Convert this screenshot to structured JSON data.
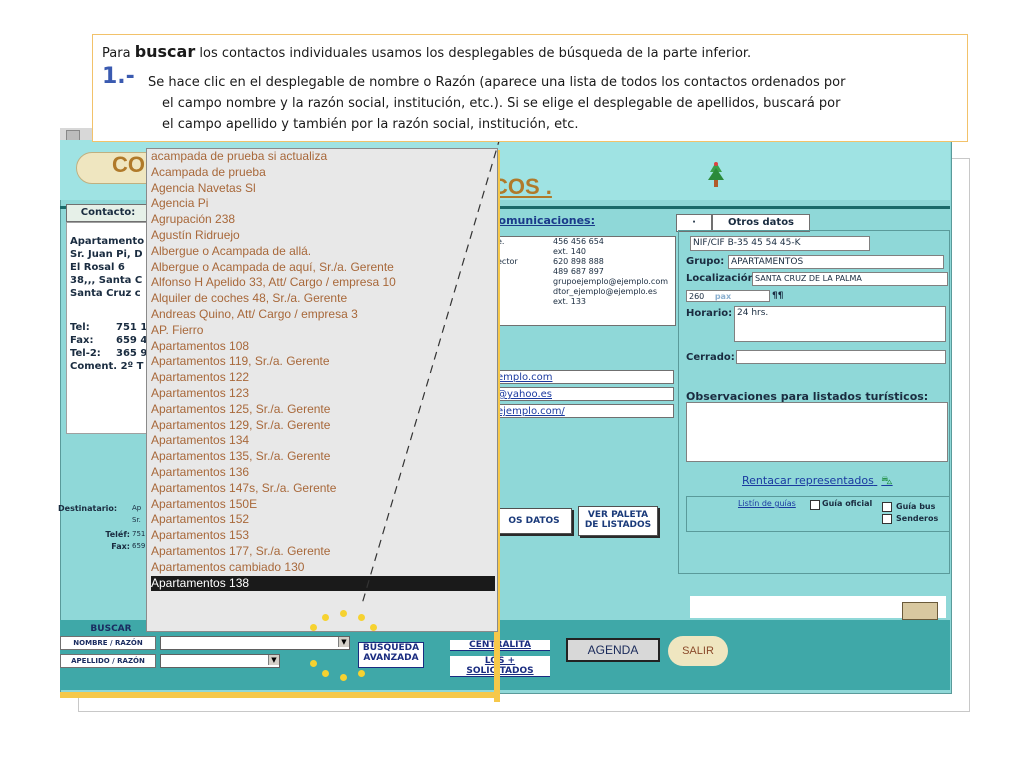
{
  "note": {
    "line1_pre": "Para",
    "line1_bold": "buscar",
    "line1_post": "los contactos individuales usamos los desplegables de búsqueda de la parte inferior.",
    "number": "1.-",
    "line2": "Se hace clic en el desplegable de nombre o Razón (aparece una lista de todos los contactos ordenados por",
    "line3": "el campo nombre y la razón social, institución, etc.). Si se elige el desplegable de apellidos, buscará por",
    "line4": "el campo apellido y también por la razón social, institución, etc."
  },
  "header": {
    "title_prefix": "CO",
    "title_suffix": "COS ."
  },
  "contact": {
    "tab_label": "Contacto:",
    "lines": [
      "Apartamento",
      "Sr. Juan Pi, D",
      "El Rosal 6",
      "38,,, Santa C",
      "Santa Cruz c"
    ],
    "tel_label": "Tel:",
    "tel_value": "751 1",
    "fax_label": "Fax:",
    "fax_value": "659 4",
    "tel2_label": "Tel-2:",
    "tel2_value": "365 9",
    "coment": "Coment. 2º T"
  },
  "destinatario": {
    "label": "Destinatario:",
    "value1": "Ap",
    "value2": "Sr.",
    "telef_label": "Teléf:",
    "telef_value": "751",
    "fax_label": "Fax:",
    "fax_value": "659"
  },
  "comms": {
    "heading": "comunicaciones:",
    "rows": [
      {
        "k": "e.",
        "v": "456 456 654"
      },
      {
        "k": "",
        "v": "ext. 140"
      },
      {
        "k": "ector",
        "v": "620 898 888"
      },
      {
        "k": "",
        "v": "489 687 897"
      },
      {
        "k": "",
        "v": "grupoejemplo@ejemplo.com"
      },
      {
        "k": "",
        "v": "dtor_ejemplo@ejemplo.es"
      },
      {
        "k": "",
        "v": "ext. 133"
      }
    ],
    "links": [
      "emplo.com",
      "@yahoo.es",
      "ejemplo.com/"
    ]
  },
  "right": {
    "tab_dot": "·",
    "tab_otros": "Otros datos",
    "nif": "NIF/CIF  B-35 45 54 45-K",
    "grupo_label": "Grupo:",
    "grupo_value": "APARTAMENTOS",
    "local_label": "Localización:",
    "local_value": "SANTA CRUZ DE LA PALMA",
    "pax_value": "260",
    "pax_label": "pax",
    "pax_mark": "¶¶",
    "horario_label": "Horario:",
    "horario_value": "24 hrs.",
    "cerrado_label": "Cerrado:",
    "obs_label": "Observaciones para listados turísticos:",
    "rentacar": "Rentacar representados",
    "listin": "Listín de guías",
    "guia_oficial": "Guía oficial",
    "guia_bus": "Guía bus",
    "senderos": "Senderos"
  },
  "mid_buttons": {
    "datos": "OS DATOS",
    "paleta_1": "VER PALETA",
    "paleta_2": "DE LISTADOS"
  },
  "bottom": {
    "buscar": "BUSCAR",
    "nombre": "NOMBRE / RAZÓN",
    "apellido": "APELLIDO / RAZÓN",
    "busq_1": "BÚSQUEDA",
    "busq_2": "AVANZADA",
    "central_1": "CENTRALITA",
    "central_2": "LOS + SOLICITADOS",
    "agenda": "AGENDA",
    "salir": "SALIR"
  },
  "dropdown": {
    "items": [
      "acampada de prueba si actualiza",
      "Acampada de prueba",
      "Agencia  Navetas Sl",
      "Agencia Pi",
      "Agrupación 238",
      "Agustín Ridruejo",
      "Albergue o Acampada  de allá.",
      "Albergue o Acampada  de aquí, Sr./a. Gerente",
      "Alfonso H Apelido  33, Att/ Cargo / empresa  10",
      "Alquiler de coches 48, Sr./a. Gerente",
      "Andreas Quino, Att/ Cargo / empresa  3",
      "AP. Fierro",
      "Apartamentos   108",
      "Apartamentos   119, Sr./a. Gerente",
      "Apartamentos   122",
      "Apartamentos   123",
      "Apartamentos   125, Sr./a. Gerente",
      "Apartamentos   129, Sr./a. Gerente",
      "Apartamentos   134",
      "Apartamentos   135, Sr./a. Gerente",
      "Apartamentos   136",
      "Apartamentos   147s, Sr./a. Gerente",
      "Apartamentos   150E",
      "Apartamentos   152",
      "Apartamentos   153",
      "Apartamentos   177, Sr./a. Gerente",
      "Apartamentos   cambiado 130",
      "Apartamentos   138"
    ],
    "selected_index": 27
  },
  "colors": {
    "accent": "#f6c84a",
    "teal": "#8fd8d8",
    "link": "#1a3aa0"
  }
}
